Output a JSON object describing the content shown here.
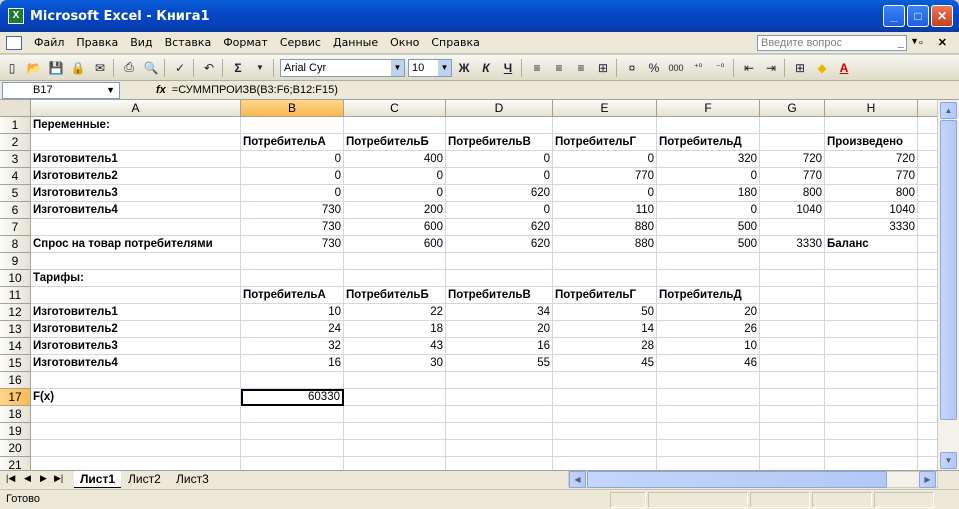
{
  "window": {
    "title": "Microsoft Excel - Книга1"
  },
  "menu": {
    "items": [
      "Файл",
      "Правка",
      "Вид",
      "Вставка",
      "Формат",
      "Сервис",
      "Данные",
      "Окно",
      "Справка"
    ],
    "help_placeholder": "Введите вопрос"
  },
  "toolbar": {
    "font": "Arial Cyr",
    "size": "10",
    "bold": "Ж",
    "italic": "К",
    "underline": "Ч",
    "percent": "%",
    "thousands": "000"
  },
  "formula_bar": {
    "name_box": "B17",
    "fx": "fx",
    "formula": "=СУММПРОИЗВ(B3:F6;B12:F15)"
  },
  "columns": [
    "A",
    "B",
    "C",
    "D",
    "E",
    "F",
    "G",
    "H"
  ],
  "rows": [
    "1",
    "2",
    "3",
    "4",
    "5",
    "6",
    "7",
    "8",
    "9",
    "10",
    "11",
    "12",
    "13",
    "14",
    "15",
    "16",
    "17",
    "18",
    "19",
    "20",
    "21"
  ],
  "cells": {
    "A1": "Переменные:",
    "B2": "ПотребительА",
    "C2": "ПотребительБ",
    "D2": "ПотребительВ",
    "E2": "ПотребительГ",
    "F2": "ПотребительД",
    "H2": "Произведено",
    "A3": "Изготовитель1",
    "B3": "0",
    "C3": "400",
    "D3": "0",
    "E3": "0",
    "F3": "320",
    "G3": "720",
    "H3": "720",
    "A4": "Изготовитель2",
    "B4": "0",
    "C4": "0",
    "D4": "0",
    "E4": "770",
    "F4": "0",
    "G4": "770",
    "H4": "770",
    "A5": "Изготовитель3",
    "B5": "0",
    "C5": "0",
    "D5": "620",
    "E5": "0",
    "F5": "180",
    "G5": "800",
    "H5": "800",
    "A6": "Изготовитель4",
    "B6": "730",
    "C6": "200",
    "D6": "0",
    "E6": "110",
    "F6": "0",
    "G6": "1040",
    "H6": "1040",
    "B7": "730",
    "C7": "600",
    "D7": "620",
    "E7": "880",
    "F7": "500",
    "H7": "3330",
    "A8": "Спрос на товар потребителями",
    "B8": "730",
    "C8": "600",
    "D8": "620",
    "E8": "880",
    "F8": "500",
    "G8": "3330",
    "H8": "Баланс",
    "A10": "Тарифы:",
    "B11": "ПотребительА",
    "C11": "ПотребительБ",
    "D11": "ПотребительВ",
    "E11": "ПотребительГ",
    "F11": "ПотребительД",
    "A12": "Изготовитель1",
    "B12": "10",
    "C12": "22",
    "D12": "34",
    "E12": "50",
    "F12": "20",
    "A13": "Изготовитель2",
    "B13": "24",
    "C13": "18",
    "D13": "20",
    "E13": "14",
    "F13": "26",
    "A14": "Изготовитель3",
    "B14": "32",
    "C14": "43",
    "D14": "16",
    "E14": "28",
    "F14": "10",
    "A15": "Изготовитель4",
    "B15": "16",
    "C15": "30",
    "D15": "55",
    "E15": "45",
    "F15": "46",
    "A17": "F(x)",
    "B17": "60330"
  },
  "sheets": [
    "Лист1",
    "Лист2",
    "Лист3"
  ],
  "status": "Готово"
}
